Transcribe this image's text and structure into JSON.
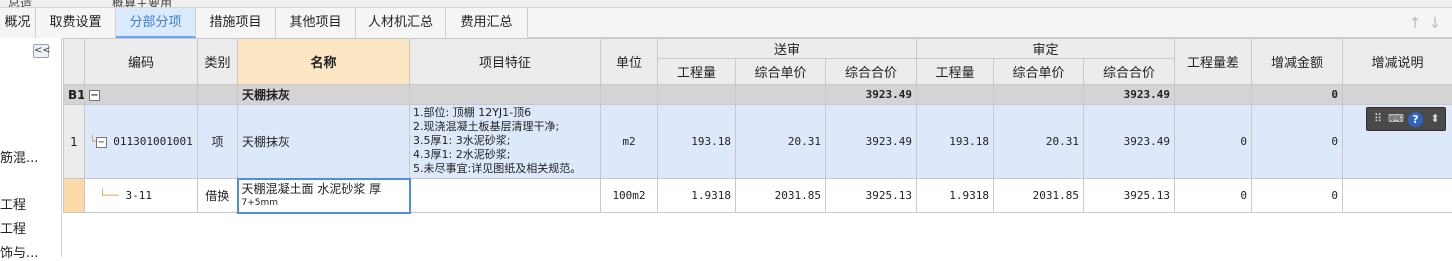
{
  "top_strip": {
    "left_text": "总造",
    "right_text": "概算主要用"
  },
  "tabs": [
    {
      "label": "概况"
    },
    {
      "label": "取费设置"
    },
    {
      "label": "分部分项"
    },
    {
      "label": "措施项目"
    },
    {
      "label": "其他项目"
    },
    {
      "label": "人材机汇总"
    },
    {
      "label": "费用汇总"
    }
  ],
  "left_panel": {
    "collapse_label": "<<",
    "items": [
      {
        "label": "筋混..."
      },
      {
        "label": "工程"
      },
      {
        "label": "工程"
      },
      {
        "label": "饰与..."
      }
    ]
  },
  "columns": {
    "code": "编码",
    "type": "类别",
    "name": "名称",
    "feature": "项目特征",
    "unit": "单位",
    "submit_group": "送审",
    "review_group": "审定",
    "quantity": "工程量",
    "unit_price": "综合单价",
    "total": "综合合价",
    "qty_diff": "工程量差",
    "amount_change": "增减金额",
    "change_note": "增减说明"
  },
  "rows": {
    "b1": {
      "idx": "B1",
      "name": "天棚抹灰",
      "submit_total": "3923.49",
      "review_total": "3923.49",
      "amount_change": "0"
    },
    "r1": {
      "idx": "1",
      "code": "011301001001",
      "type": "项",
      "name": "天棚抹灰",
      "feature": [
        "1.部位: 顶棚  12YJ1-顶6",
        "2.现浇混凝土板基层清理干净;",
        "3.5厚1: 3水泥砂浆;",
        "4.3厚1: 2水泥砂浆;",
        "5.未尽事宜:详见图纸及相关规范。"
      ],
      "unit": "m2",
      "submit_qty": "193.18",
      "submit_price": "20.31",
      "submit_total": "3923.49",
      "review_qty": "193.18",
      "review_price": "20.31",
      "review_total": "3923.49",
      "qty_diff": "0",
      "amount_change": "0"
    },
    "r2": {
      "code": "3-11",
      "type": "借换",
      "name_line1": "天棚混凝土面 水泥砂浆 厚",
      "name_line2": "7+5mm",
      "unit": "100m2",
      "submit_qty": "1.9318",
      "submit_price": "2031.85",
      "submit_total": "3925.13",
      "review_qty": "1.9318",
      "review_price": "2031.85",
      "review_total": "3925.13",
      "qty_diff": "0",
      "amount_change": "0"
    }
  },
  "tree_toggle": "−",
  "float_toolbar": {
    "icons": [
      "grip-icon",
      "keyboard-icon",
      "help-icon",
      "dropdown-icon"
    ],
    "help_label": "?"
  },
  "nav_arrows": [
    "↑",
    "↓"
  ]
}
